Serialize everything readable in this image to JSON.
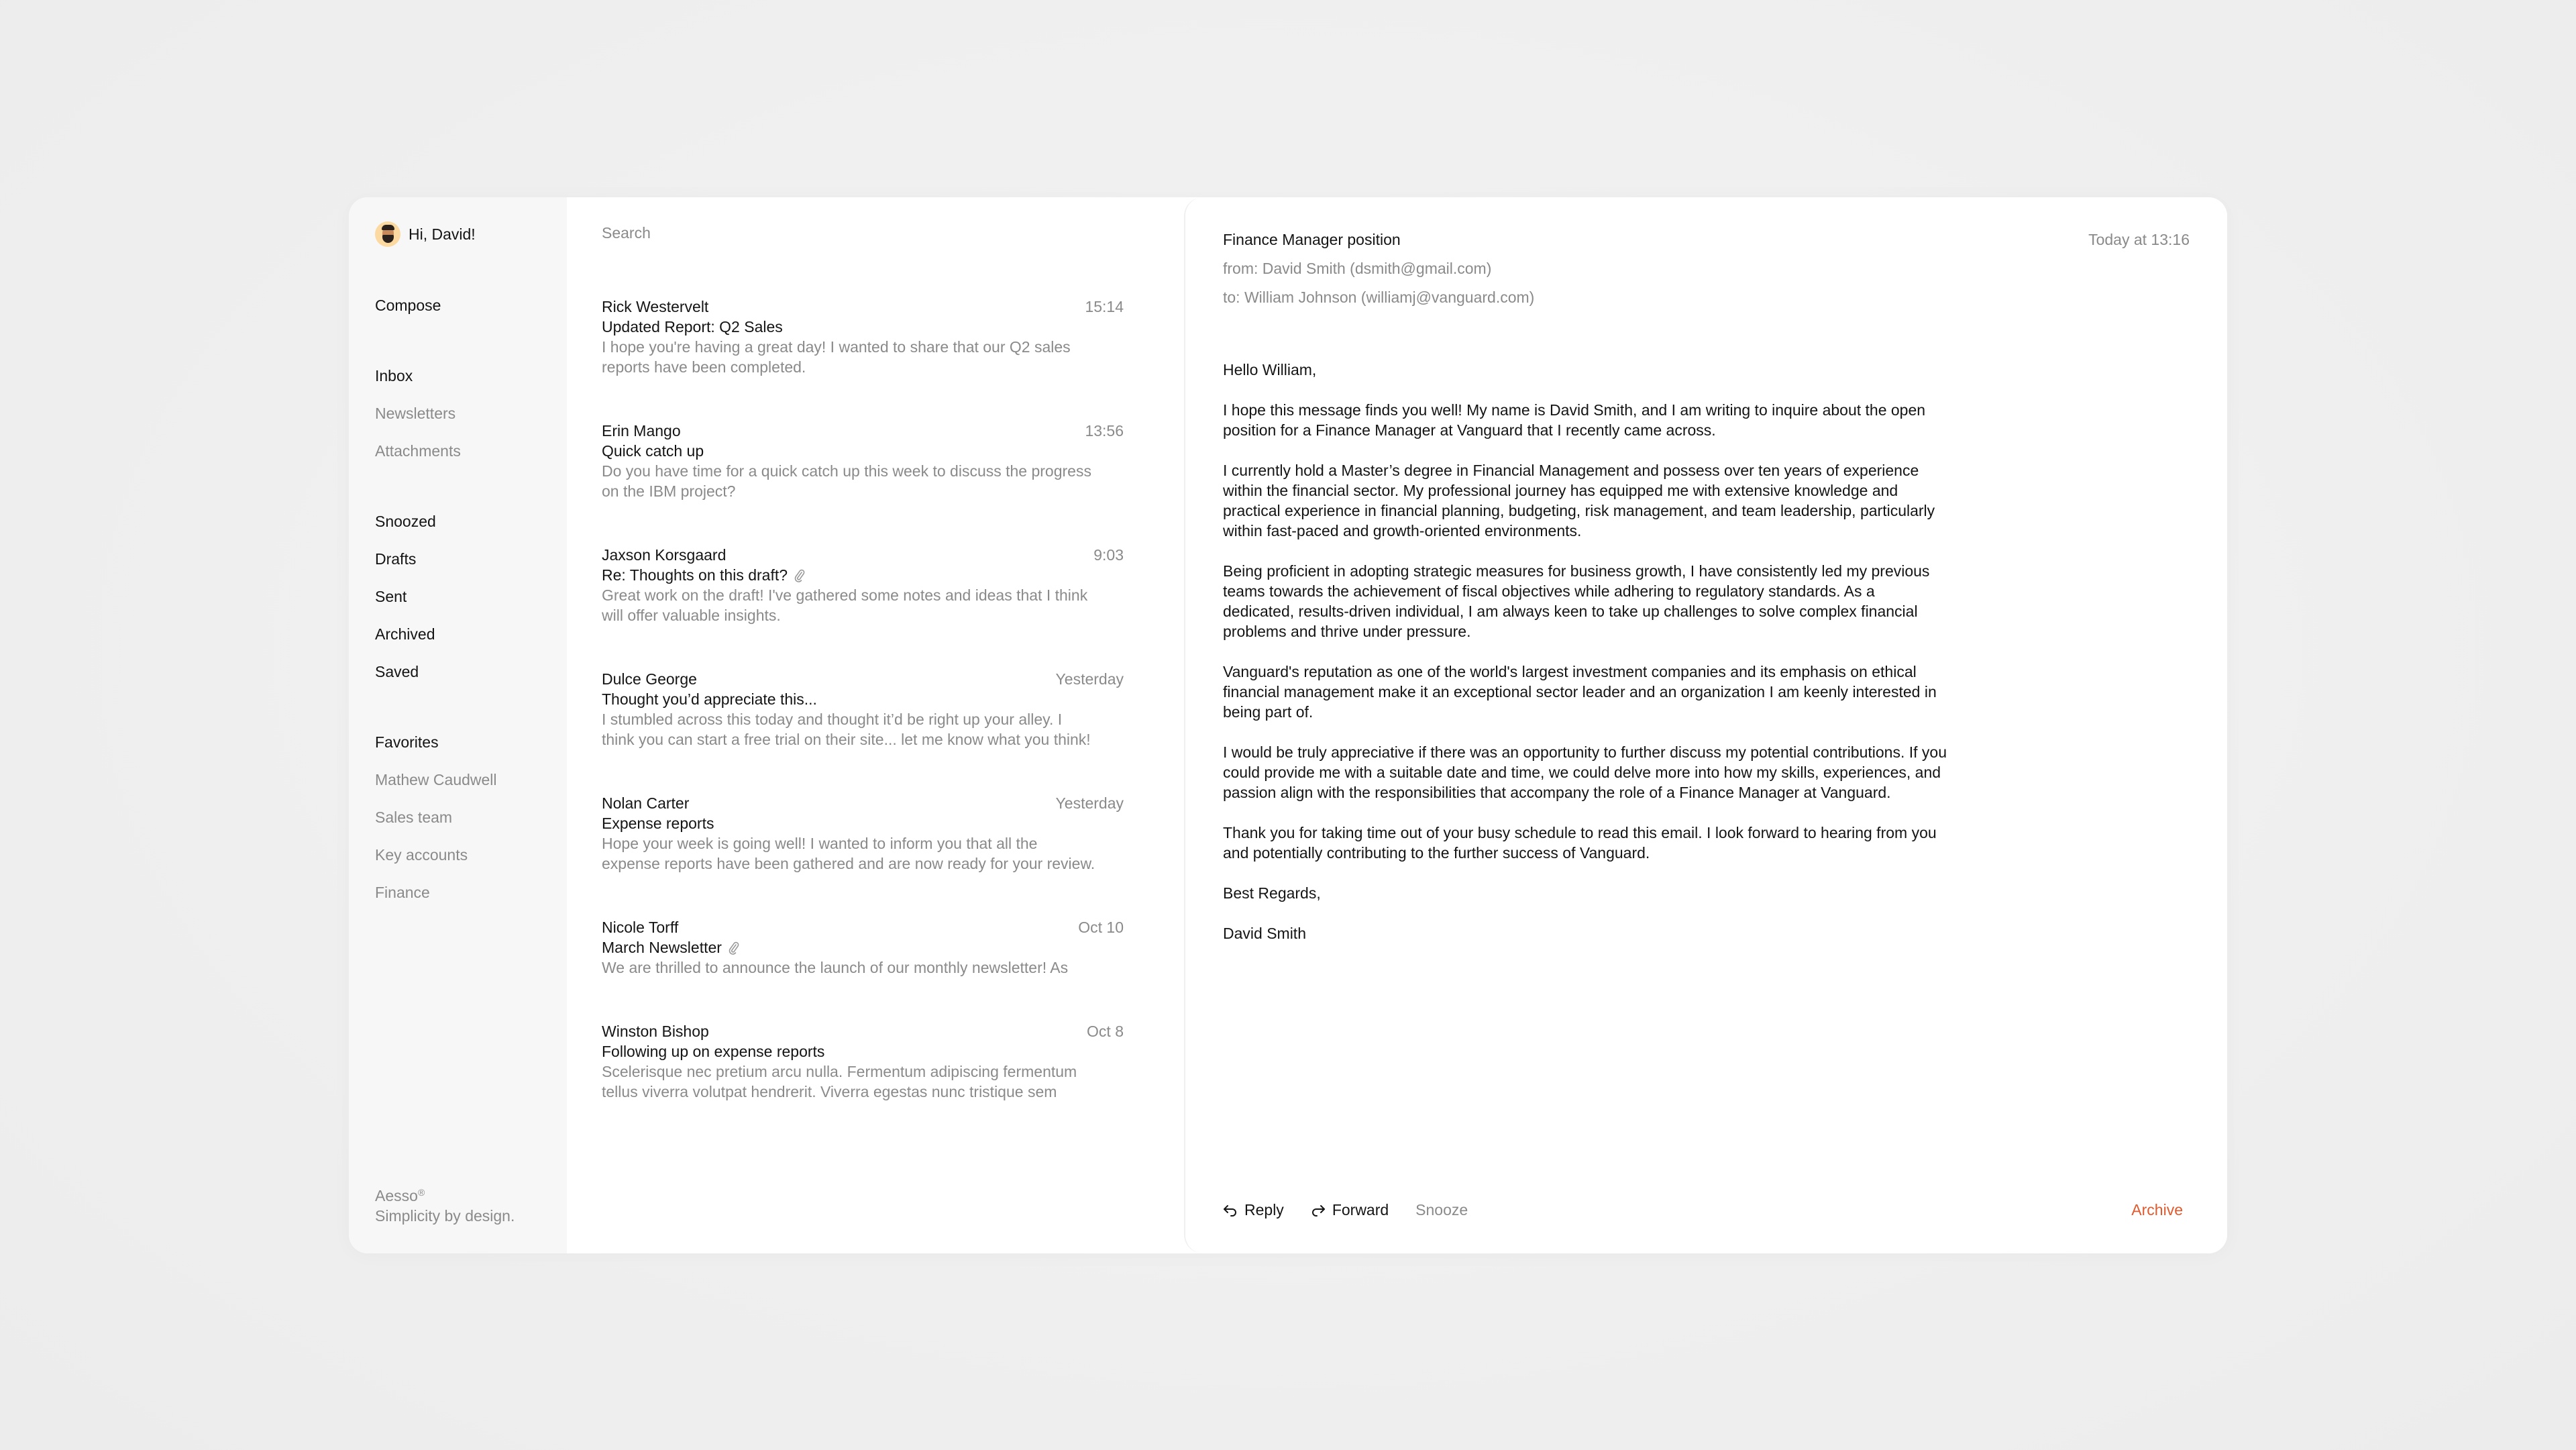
{
  "sidebar": {
    "greeting": "Hi, David!",
    "avatar_icon": "memoji-avatar",
    "compose": "Compose",
    "mailbox_items": [
      {
        "label": "Inbox",
        "muted": false
      },
      {
        "label": "Newsletters",
        "muted": true
      },
      {
        "label": "Attachments",
        "muted": true
      }
    ],
    "folder_items": [
      {
        "label": "Snoozed"
      },
      {
        "label": "Drafts"
      },
      {
        "label": "Sent"
      },
      {
        "label": "Archived"
      },
      {
        "label": "Saved"
      }
    ],
    "favorites_heading": "Favorites",
    "favorites": [
      {
        "label": "Mathew Caudwell"
      },
      {
        "label": "Sales team"
      },
      {
        "label": "Key accounts"
      },
      {
        "label": "Finance"
      }
    ],
    "brand_name": "Aesso",
    "brand_mark": "®",
    "brand_tagline": "Simplicity by design."
  },
  "list": {
    "search_placeholder": "Search",
    "emails": [
      {
        "sender": "Rick Westervelt",
        "time": "15:14",
        "subject": "Updated Report: Q2 Sales",
        "attachment": false,
        "preview_lines": [
          "I hope you're having a great day! I wanted to share that our Q2 sales",
          "reports have been completed."
        ]
      },
      {
        "sender": "Erin Mango",
        "time": "13:56",
        "subject": "Quick catch up",
        "attachment": false,
        "preview_lines": [
          "Do you have time for a quick catch up this week to discuss the progress",
          "on the IBM project?"
        ]
      },
      {
        "sender": "Jaxson Korsgaard",
        "time": "9:03",
        "subject": "Re: Thoughts on this draft?",
        "attachment": true,
        "preview_lines": [
          "Great work on the draft! I've gathered some notes and ideas that I think",
          "will offer valuable insights."
        ]
      },
      {
        "sender": "Dulce George",
        "time": "Yesterday",
        "subject": "Thought you’d appreciate this...",
        "attachment": false,
        "preview_lines": [
          "I stumbled across this today and thought it’d be right up your alley. I",
          "think you can start a free trial on their site... let me know what you think!"
        ]
      },
      {
        "sender": "Nolan Carter",
        "time": "Yesterday",
        "subject": "Expense reports",
        "attachment": false,
        "preview_lines": [
          "Hope your week is going well! I wanted to inform you that all the",
          "expense reports have been gathered and are now ready for your review."
        ]
      },
      {
        "sender": "Nicole Torff",
        "time": "Oct 10",
        "subject": "March Newsletter",
        "attachment": true,
        "preview_lines": [
          "We are thrilled to announce the launch of our monthly newsletter! As"
        ]
      },
      {
        "sender": "Winston Bishop",
        "time": "Oct 8",
        "subject": "Following up on expense reports",
        "attachment": false,
        "preview_lines": [
          "Scelerisque nec pretium arcu nulla. Fermentum adipiscing fermentum",
          "tellus viverra volutpat hendrerit. Viverra egestas nunc tristique sem"
        ]
      }
    ]
  },
  "reader": {
    "subject": "Finance Manager position",
    "date": "Today at 13:16",
    "from": "from: David Smith (dsmith@gmail.com)",
    "to": "to: William Johnson (williamj@vanguard.com)",
    "body": [
      "Hello William,",
      "I hope this message finds you well! My name is David Smith, and I am writing to inquire about the open position for a Finance Manager at Vanguard that I recently came across.",
      "I currently hold a Master’s degree in Financial Management and possess over ten years of experience within the financial sector. My professional journey has equipped me with extensive knowledge and practical experience in financial planning, budgeting, risk management, and team leadership, particularly within fast-paced and growth-oriented environments.",
      "Being proficient in adopting strategic measures for business growth, I have consistently led my previous teams towards the achievement of fiscal objectives while adhering to regulatory standards. As a dedicated, results-driven individual, I am always keen to take up challenges to solve complex financial problems and thrive under pressure.",
      "Vanguard's reputation as one of the world's largest investment companies and its emphasis on ethical financial management make it an exceptional sector leader and an organization I am keenly interested in being part of.",
      "I would be truly appreciative if there was an opportunity to further discuss my potential contributions. If you could provide me with a suitable date and time, we could delve more into how my skills, experiences, and passion align with the responsibilities that accompany the role of a Finance Manager at Vanguard.",
      "Thank you for taking time out of your busy schedule to read this email. I look forward to hearing from you and potentially contributing to the further success of Vanguard.",
      "Best Regards,",
      "David Smith"
    ],
    "actions": {
      "reply": "Reply",
      "forward": "Forward",
      "snooze": "Snooze",
      "archive": "Archive"
    }
  },
  "colors": {
    "accent_archive": "#e05a2e",
    "text_primary": "#141414",
    "text_muted": "#8a8a8a",
    "sidebar_bg": "#f7f7f7",
    "page_bg": "#efefef"
  }
}
